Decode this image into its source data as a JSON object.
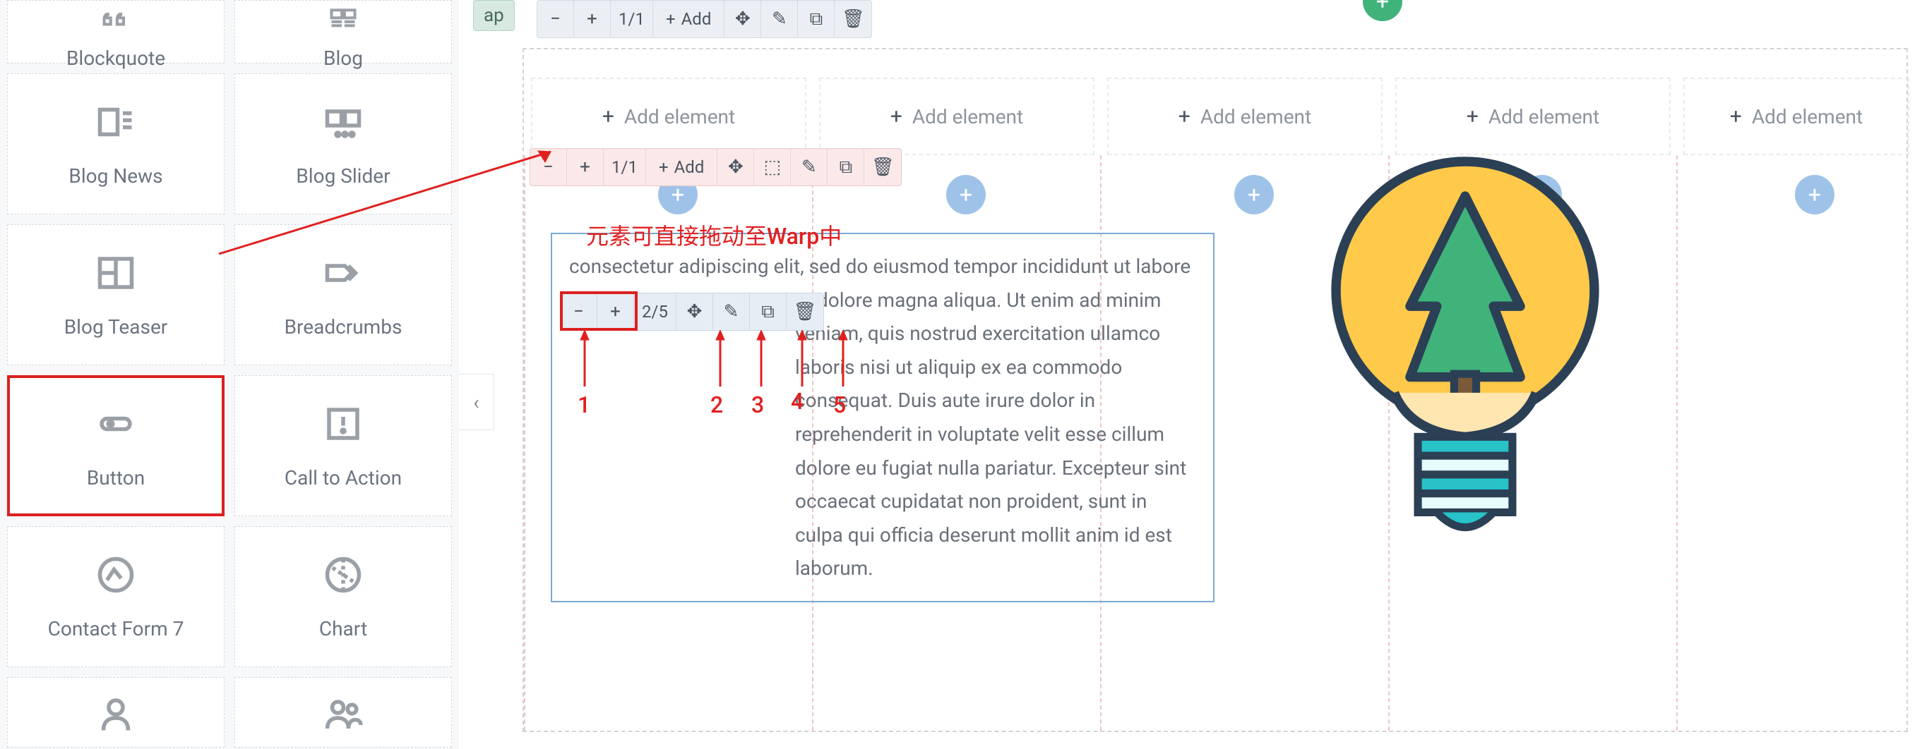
{
  "sidebar": {
    "items": [
      {
        "label": "Blockquote",
        "icon": "quote-icon"
      },
      {
        "label": "Blog",
        "icon": "blog-icon"
      },
      {
        "label": "Blog News",
        "icon": "blog-news-icon"
      },
      {
        "label": "Blog Slider",
        "icon": "blog-slider-icon"
      },
      {
        "label": "Blog Teaser",
        "icon": "blog-teaser-icon"
      },
      {
        "label": "Breadcrumbs",
        "icon": "breadcrumbs-icon"
      },
      {
        "label": "Button",
        "icon": "button-icon"
      },
      {
        "label": "Call to Action",
        "icon": "cta-icon"
      },
      {
        "label": "Contact Form 7",
        "icon": "contact-form-icon"
      },
      {
        "label": "Chart",
        "icon": "chart-icon"
      },
      {
        "label": "",
        "icon": "person-icon"
      },
      {
        "label": "",
        "icon": "people-icon"
      }
    ]
  },
  "canvas": {
    "tab": "ap",
    "toolbar1": {
      "frac": "1/1",
      "add": "Add"
    },
    "toolbar2": {
      "frac": "1/1",
      "add": "Add"
    },
    "toolbar3": {
      "frac": "2/5"
    },
    "columns": [
      "Add element",
      "Add element",
      "Add element",
      "Add element",
      "Add element"
    ],
    "lorem": "consectetur adipiscing elit, sed do eiusmod tempor incididunt ut labore et dolore magna aliqua. Ut enim ad minim veniam, quis nostrud exercitation ullamco laboris nisi ut aliquip ex ea commodo consequat. Duis aute irure dolor in reprehenderit in voluptate velit esse cillum dolore eu fugiat nulla pariatur. Excepteur sint occaecat cupidatat non proident, sunt in culpa qui officia deserunt mollit anim id est laborum."
  },
  "annotation": {
    "hint": "元素可直接拖动至Warp中",
    "n1": "1",
    "n2": "2",
    "n3": "3",
    "n4": "4",
    "n5": "5"
  }
}
